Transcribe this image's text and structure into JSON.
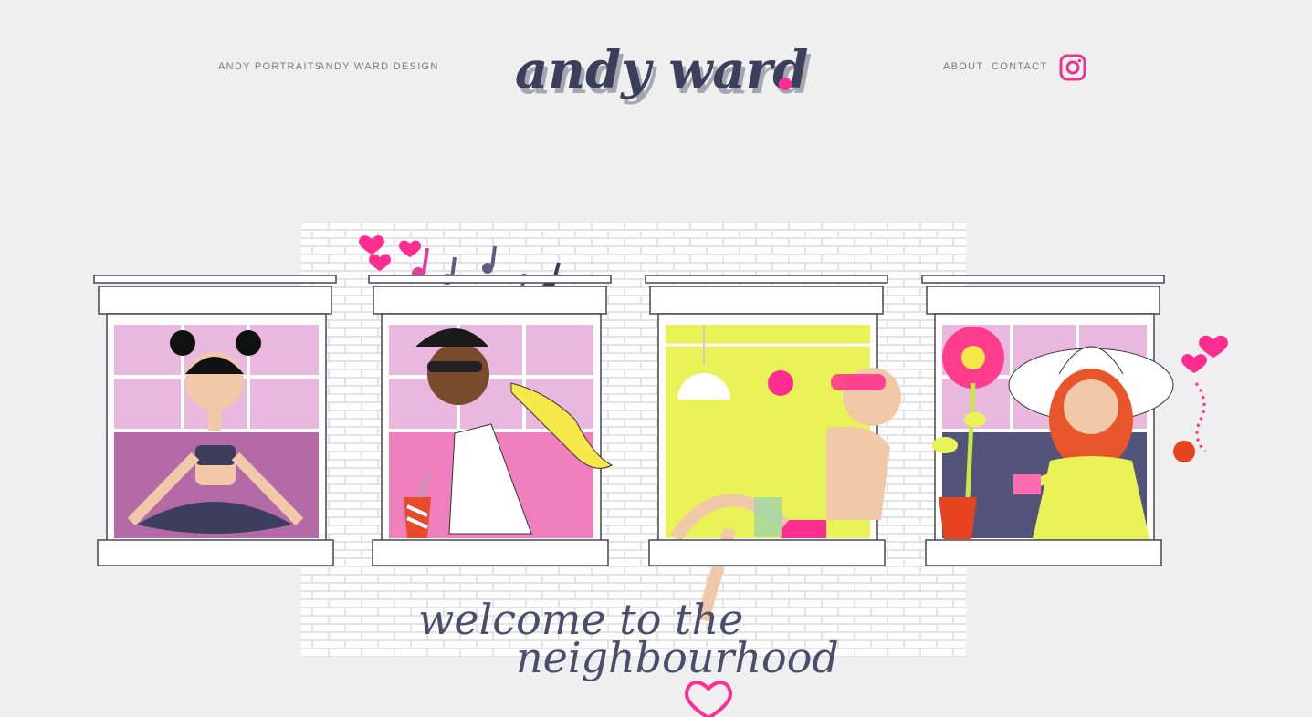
{
  "nav": {
    "left": [
      {
        "label": "ANDY PORTRAITS"
      },
      {
        "label": "ANDY WARD DESIGN"
      }
    ],
    "right": [
      {
        "label": "ABOUT"
      },
      {
        "label": "CONTACT"
      }
    ]
  },
  "logo": {
    "text": "andy ward",
    "dot_color": "#ff2d8f",
    "text_color": "#3b3f5c"
  },
  "social": {
    "icon": "instagram-icon",
    "color": "#e8358d"
  },
  "hero": {
    "line1": "welcome to the",
    "line2": "neighbourhood",
    "colors": {
      "ink": "#4a4d6b",
      "accent": "#ff2d8f",
      "lime": "#e9f257",
      "lilac": "#d6a8d3",
      "pink": "#f2a7cf",
      "navy": "#52547a"
    }
  }
}
